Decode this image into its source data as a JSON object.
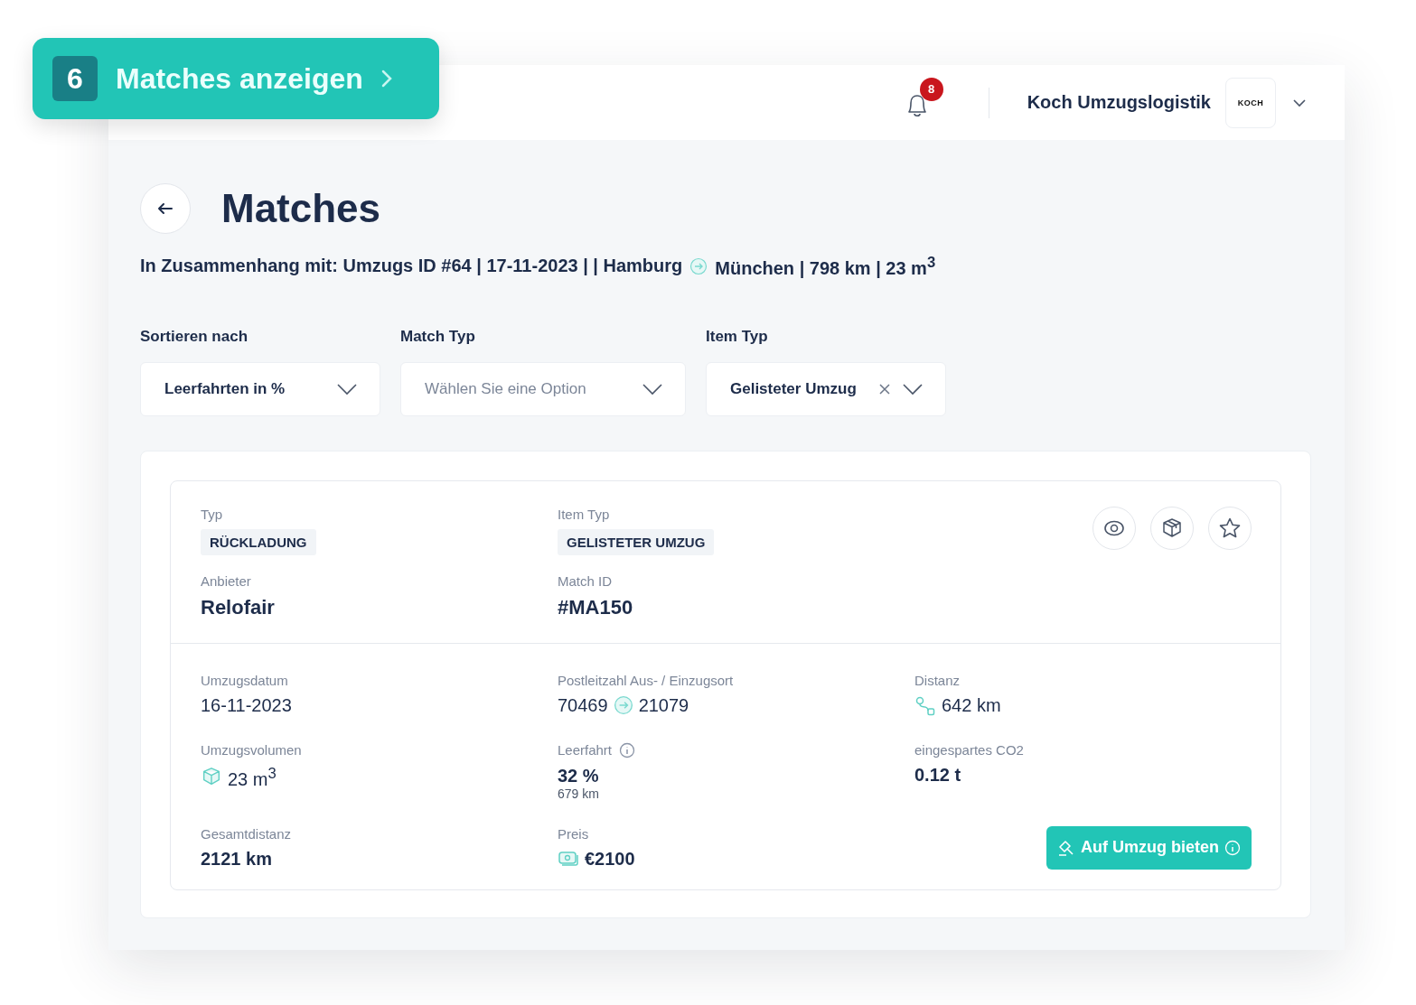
{
  "promo_button": {
    "count": "6",
    "label": "Matches anzeigen"
  },
  "header": {
    "notification_count": "8",
    "company": "Koch Umzugslogistik",
    "logo_text": "KOCH"
  },
  "page": {
    "title": "Matches",
    "context_from": "In Zusammenhang mit: Umzugs ID #64 | 17-11-2023 | | Hamburg",
    "context_to": "München | 798 km | 23 m$^{3}$"
  },
  "filters": [
    {
      "label": "Sortieren nach",
      "value": "Leerfahrten in %",
      "clearable": false
    },
    {
      "label": "Match Typ",
      "placeholder": "Wählen Sie eine Option",
      "clearable": false
    },
    {
      "label": "Item Typ",
      "value": "Gelisteter Umzug",
      "clearable": true
    }
  ],
  "match": {
    "summary": [
      {
        "label": "Typ",
        "tag": "RÜCKLADUNG"
      },
      {
        "label": "Item Typ",
        "tag": "GELISTETER UMZUG"
      },
      {
        "label": "Anbieter",
        "value": "Relofair"
      },
      {
        "label": "Match ID",
        "value": "#MA150"
      }
    ],
    "details": [
      {
        "kind": "text",
        "label": "Umzugsdatum",
        "value": "16-11-2023"
      },
      {
        "kind": "route",
        "label": "Postleitzahl Aus- / Einzugsort",
        "from": "70469",
        "to": "21079"
      },
      {
        "kind": "distance",
        "label": "Distanz",
        "value": "642 km"
      },
      {
        "kind": "volume",
        "label": "Umzugsvolumen",
        "value": "23 m$^{3}$"
      },
      {
        "kind": "bold",
        "label": "Leerfahrt",
        "value": "32 %",
        "sub": "679 km",
        "info": true
      },
      {
        "kind": "bold",
        "label": "eingespartes CO2",
        "value": "0.12 t"
      },
      {
        "kind": "bold",
        "label": "Gesamtdistanz",
        "value": "2121 km"
      },
      {
        "kind": "price",
        "label": "Preis",
        "value": "€2100"
      }
    ],
    "bid_button": "Auf Umzug bieten"
  }
}
